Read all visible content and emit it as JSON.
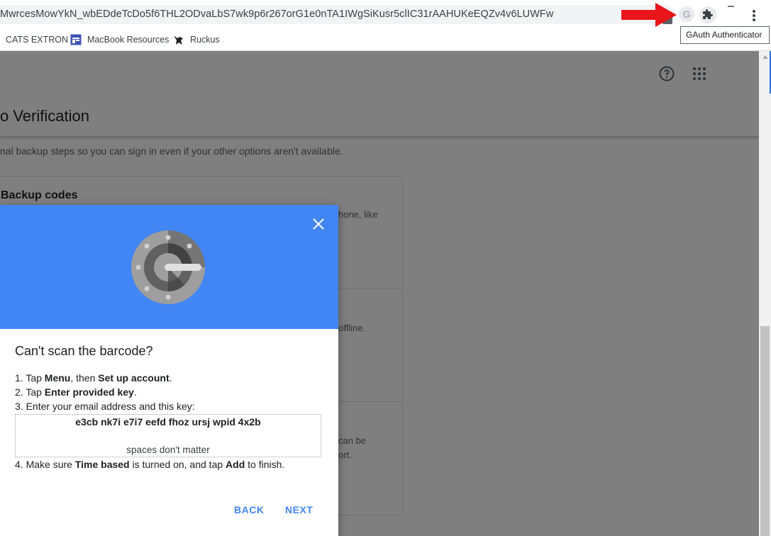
{
  "browser": {
    "url": "MwrcesMowYkN_wbEDdeTcDo5f6THL2ODvaLbS7wk9p6r267orG1e0nTA1IWgSiKusr5clIC31rAAHUKeEQZv4v6LUWFw",
    "extension_tooltip": "GAuth Authenticator",
    "extension_badge": "G",
    "bookmarks": [
      {
        "label": "CATS EXTRON"
      },
      {
        "label": "MacBook Resources"
      },
      {
        "label": "Ruckus"
      }
    ]
  },
  "page": {
    "title": "o Verification",
    "subtitle": "nal backup steps so you can sign in even if your other options aren't available.",
    "card": {
      "title": "Backup codes",
      "fragments": [
        "hone, like",
        "s offline.",
        "can be",
        "ort."
      ]
    }
  },
  "modal": {
    "title": "Can't scan the barcode?",
    "steps": {
      "s1": {
        "num": "1. ",
        "a": "Tap ",
        "b": "Menu",
        "c": ", then ",
        "d": "Set up account",
        "e": "."
      },
      "s2": {
        "num": "2. ",
        "a": "Tap ",
        "b": "Enter provided key",
        "c": "."
      },
      "s3": {
        "text": "3. Enter your email address and this key:"
      },
      "s4": {
        "num": "4. ",
        "a": "Make sure ",
        "b": "Time based",
        "c": " is turned on, and tap ",
        "d": "Add",
        "e": " to finish."
      }
    },
    "key": "e3cb nk7i e7i7 eefd fhoz ursj wpid 4x2b",
    "key_note": "spaces don't matter",
    "back_label": "BACK",
    "next_label": "NEXT"
  },
  "colors": {
    "accent": "#4285f4",
    "arrow": "#e8151b"
  }
}
